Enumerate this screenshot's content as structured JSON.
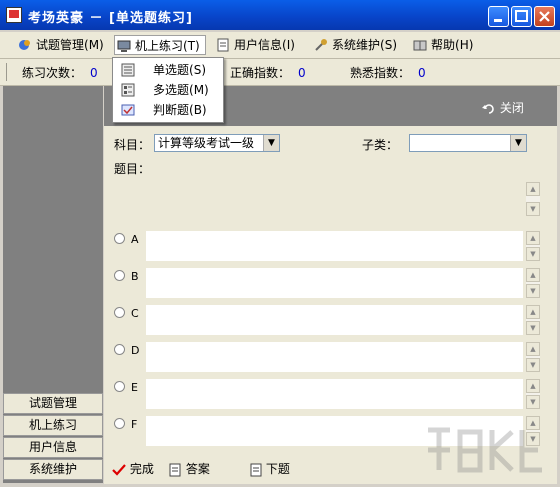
{
  "window": {
    "title": "考场英豪 － [单选题练习]"
  },
  "menubar": {
    "items": [
      {
        "label": "试题管理",
        "accel": "(M)",
        "icon": "question-manage-icon"
      },
      {
        "label": "机上练习",
        "accel": "(T)",
        "icon": "computer-practice-icon"
      },
      {
        "label": "用户信息",
        "accel": "(I)",
        "icon": "user-info-icon"
      },
      {
        "label": "系统维护",
        "accel": "(S)",
        "icon": "system-maintenance-icon"
      },
      {
        "label": "帮助",
        "accel": "(H)",
        "icon": "help-book-icon"
      }
    ]
  },
  "dropdown": {
    "items": [
      {
        "label": "单选题",
        "accel": "(S)",
        "icon": "single-choice-icon"
      },
      {
        "label": "多选题",
        "accel": "(M)",
        "icon": "multiple-choice-icon"
      },
      {
        "label": "判断题",
        "accel": "(B)",
        "icon": "true-false-icon"
      }
    ]
  },
  "stats": {
    "practice_count_label": "练习次数：",
    "practice_count_value": "0",
    "correct_index_label": "正确指数：",
    "correct_index_value": "0",
    "familiar_index_label": "熟悉指数：",
    "familiar_index_value": "0"
  },
  "sidebar": {
    "buttons": [
      "试题管理",
      "机上练习",
      "用户信息",
      "系统维护"
    ]
  },
  "header": {
    "close_label": "关闭",
    "close_icon": "undo-arrow-icon"
  },
  "form": {
    "subject_label": "科目：",
    "subject_value": "计算等级考试一级",
    "subcategory_label": "子类：",
    "subcategory_value": "",
    "question_label": "题目："
  },
  "options": [
    "A",
    "B",
    "C",
    "D",
    "E",
    "F"
  ],
  "actions": {
    "finish_label": "完成",
    "answer_label": "答案",
    "next_label": "下题"
  }
}
